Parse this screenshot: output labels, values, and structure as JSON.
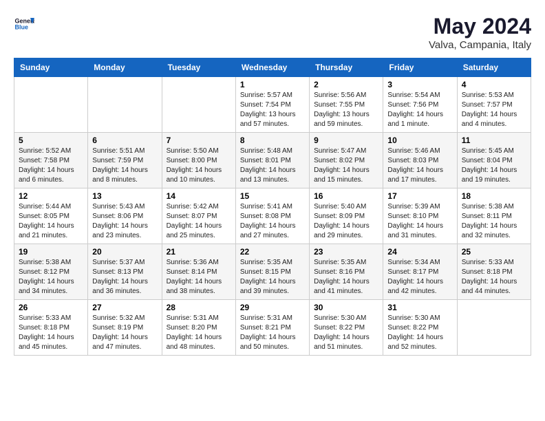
{
  "header": {
    "logo_text_general": "General",
    "logo_text_blue": "Blue",
    "month": "May 2024",
    "location": "Valva, Campania, Italy"
  },
  "weekdays": [
    "Sunday",
    "Monday",
    "Tuesday",
    "Wednesday",
    "Thursday",
    "Friday",
    "Saturday"
  ],
  "weeks": [
    [
      {
        "day": "",
        "sunrise": "",
        "sunset": "",
        "daylight": ""
      },
      {
        "day": "",
        "sunrise": "",
        "sunset": "",
        "daylight": ""
      },
      {
        "day": "",
        "sunrise": "",
        "sunset": "",
        "daylight": ""
      },
      {
        "day": "1",
        "sunrise": "Sunrise: 5:57 AM",
        "sunset": "Sunset: 7:54 PM",
        "daylight": "Daylight: 13 hours and 57 minutes."
      },
      {
        "day": "2",
        "sunrise": "Sunrise: 5:56 AM",
        "sunset": "Sunset: 7:55 PM",
        "daylight": "Daylight: 13 hours and 59 minutes."
      },
      {
        "day": "3",
        "sunrise": "Sunrise: 5:54 AM",
        "sunset": "Sunset: 7:56 PM",
        "daylight": "Daylight: 14 hours and 1 minute."
      },
      {
        "day": "4",
        "sunrise": "Sunrise: 5:53 AM",
        "sunset": "Sunset: 7:57 PM",
        "daylight": "Daylight: 14 hours and 4 minutes."
      }
    ],
    [
      {
        "day": "5",
        "sunrise": "Sunrise: 5:52 AM",
        "sunset": "Sunset: 7:58 PM",
        "daylight": "Daylight: 14 hours and 6 minutes."
      },
      {
        "day": "6",
        "sunrise": "Sunrise: 5:51 AM",
        "sunset": "Sunset: 7:59 PM",
        "daylight": "Daylight: 14 hours and 8 minutes."
      },
      {
        "day": "7",
        "sunrise": "Sunrise: 5:50 AM",
        "sunset": "Sunset: 8:00 PM",
        "daylight": "Daylight: 14 hours and 10 minutes."
      },
      {
        "day": "8",
        "sunrise": "Sunrise: 5:48 AM",
        "sunset": "Sunset: 8:01 PM",
        "daylight": "Daylight: 14 hours and 13 minutes."
      },
      {
        "day": "9",
        "sunrise": "Sunrise: 5:47 AM",
        "sunset": "Sunset: 8:02 PM",
        "daylight": "Daylight: 14 hours and 15 minutes."
      },
      {
        "day": "10",
        "sunrise": "Sunrise: 5:46 AM",
        "sunset": "Sunset: 8:03 PM",
        "daylight": "Daylight: 14 hours and 17 minutes."
      },
      {
        "day": "11",
        "sunrise": "Sunrise: 5:45 AM",
        "sunset": "Sunset: 8:04 PM",
        "daylight": "Daylight: 14 hours and 19 minutes."
      }
    ],
    [
      {
        "day": "12",
        "sunrise": "Sunrise: 5:44 AM",
        "sunset": "Sunset: 8:05 PM",
        "daylight": "Daylight: 14 hours and 21 minutes."
      },
      {
        "day": "13",
        "sunrise": "Sunrise: 5:43 AM",
        "sunset": "Sunset: 8:06 PM",
        "daylight": "Daylight: 14 hours and 23 minutes."
      },
      {
        "day": "14",
        "sunrise": "Sunrise: 5:42 AM",
        "sunset": "Sunset: 8:07 PM",
        "daylight": "Daylight: 14 hours and 25 minutes."
      },
      {
        "day": "15",
        "sunrise": "Sunrise: 5:41 AM",
        "sunset": "Sunset: 8:08 PM",
        "daylight": "Daylight: 14 hours and 27 minutes."
      },
      {
        "day": "16",
        "sunrise": "Sunrise: 5:40 AM",
        "sunset": "Sunset: 8:09 PM",
        "daylight": "Daylight: 14 hours and 29 minutes."
      },
      {
        "day": "17",
        "sunrise": "Sunrise: 5:39 AM",
        "sunset": "Sunset: 8:10 PM",
        "daylight": "Daylight: 14 hours and 31 minutes."
      },
      {
        "day": "18",
        "sunrise": "Sunrise: 5:38 AM",
        "sunset": "Sunset: 8:11 PM",
        "daylight": "Daylight: 14 hours and 32 minutes."
      }
    ],
    [
      {
        "day": "19",
        "sunrise": "Sunrise: 5:38 AM",
        "sunset": "Sunset: 8:12 PM",
        "daylight": "Daylight: 14 hours and 34 minutes."
      },
      {
        "day": "20",
        "sunrise": "Sunrise: 5:37 AM",
        "sunset": "Sunset: 8:13 PM",
        "daylight": "Daylight: 14 hours and 36 minutes."
      },
      {
        "day": "21",
        "sunrise": "Sunrise: 5:36 AM",
        "sunset": "Sunset: 8:14 PM",
        "daylight": "Daylight: 14 hours and 38 minutes."
      },
      {
        "day": "22",
        "sunrise": "Sunrise: 5:35 AM",
        "sunset": "Sunset: 8:15 PM",
        "daylight": "Daylight: 14 hours and 39 minutes."
      },
      {
        "day": "23",
        "sunrise": "Sunrise: 5:35 AM",
        "sunset": "Sunset: 8:16 PM",
        "daylight": "Daylight: 14 hours and 41 minutes."
      },
      {
        "day": "24",
        "sunrise": "Sunrise: 5:34 AM",
        "sunset": "Sunset: 8:17 PM",
        "daylight": "Daylight: 14 hours and 42 minutes."
      },
      {
        "day": "25",
        "sunrise": "Sunrise: 5:33 AM",
        "sunset": "Sunset: 8:18 PM",
        "daylight": "Daylight: 14 hours and 44 minutes."
      }
    ],
    [
      {
        "day": "26",
        "sunrise": "Sunrise: 5:33 AM",
        "sunset": "Sunset: 8:18 PM",
        "daylight": "Daylight: 14 hours and 45 minutes."
      },
      {
        "day": "27",
        "sunrise": "Sunrise: 5:32 AM",
        "sunset": "Sunset: 8:19 PM",
        "daylight": "Daylight: 14 hours and 47 minutes."
      },
      {
        "day": "28",
        "sunrise": "Sunrise: 5:31 AM",
        "sunset": "Sunset: 8:20 PM",
        "daylight": "Daylight: 14 hours and 48 minutes."
      },
      {
        "day": "29",
        "sunrise": "Sunrise: 5:31 AM",
        "sunset": "Sunset: 8:21 PM",
        "daylight": "Daylight: 14 hours and 50 minutes."
      },
      {
        "day": "30",
        "sunrise": "Sunrise: 5:30 AM",
        "sunset": "Sunset: 8:22 PM",
        "daylight": "Daylight: 14 hours and 51 minutes."
      },
      {
        "day": "31",
        "sunrise": "Sunrise: 5:30 AM",
        "sunset": "Sunset: 8:22 PM",
        "daylight": "Daylight: 14 hours and 52 minutes."
      },
      {
        "day": "",
        "sunrise": "",
        "sunset": "",
        "daylight": ""
      }
    ]
  ]
}
